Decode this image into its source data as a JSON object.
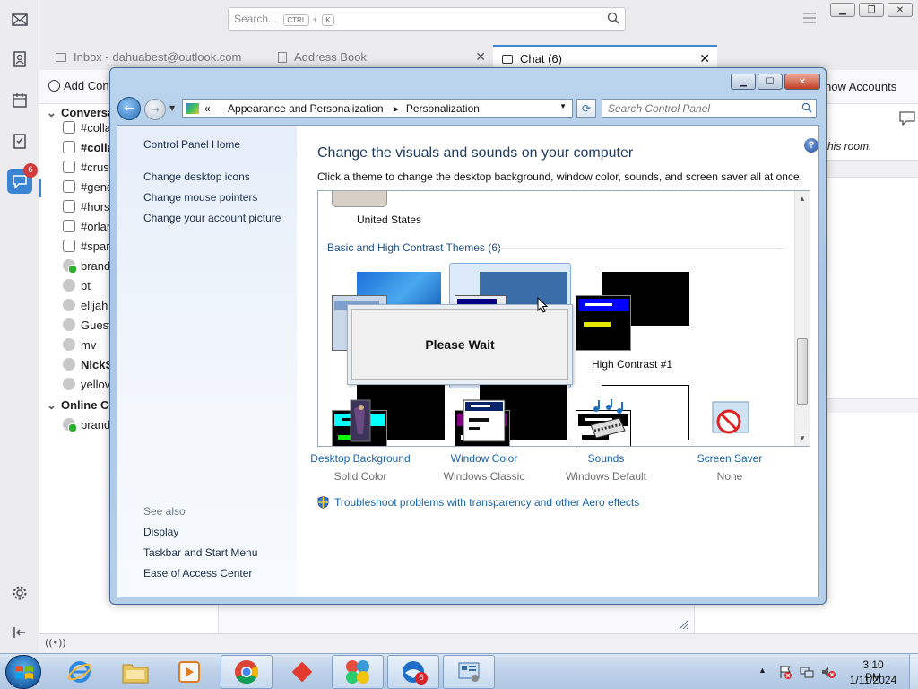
{
  "thunderbird": {
    "search_placeholder": "Search...",
    "search_kbd": [
      "CTRL",
      "K"
    ],
    "search_plus": "+",
    "tabs": [
      {
        "label": "Inbox - dahuabest@outlook.com"
      },
      {
        "label": "Address Book"
      },
      {
        "label": "Chat (6)"
      }
    ],
    "add_contact_label": "Add Cont",
    "show_accounts_label": "how Accounts",
    "chat_badge": "6",
    "groups": [
      {
        "label": "Conversat"
      },
      {
        "label": "Online Co"
      }
    ],
    "conversations": [
      {
        "label": "#colla",
        "bold": false,
        "kind": "room"
      },
      {
        "label": "#colla",
        "bold": true,
        "kind": "room"
      },
      {
        "label": "#crust",
        "bold": false,
        "kind": "room"
      },
      {
        "label": "#gene",
        "bold": false,
        "kind": "room"
      },
      {
        "label": "#hors",
        "bold": false,
        "kind": "room"
      },
      {
        "label": "#orlar",
        "bold": false,
        "kind": "room"
      },
      {
        "label": "#span",
        "bold": false,
        "kind": "room"
      },
      {
        "label": "brand",
        "bold": false,
        "kind": "online"
      },
      {
        "label": "bt",
        "bold": false,
        "kind": "person"
      },
      {
        "label": "elijah",
        "bold": false,
        "kind": "person"
      },
      {
        "label": "Guest",
        "bold": false,
        "kind": "person"
      },
      {
        "label": "mv",
        "bold": false,
        "kind": "person"
      },
      {
        "label": "NickS",
        "bold": true,
        "kind": "person"
      },
      {
        "label": "yellov",
        "bold": false,
        "kind": "person"
      }
    ],
    "online_contacts": [
      {
        "label": "brand",
        "kind": "online"
      }
    ],
    "room_note": "his room."
  },
  "control_panel": {
    "breadcrumb_prefix": "«",
    "breadcrumb": [
      "Appearance and Personalization",
      "Personalization"
    ],
    "search_placeholder": "Search Control Panel",
    "left_links": [
      {
        "label": "Control Panel Home"
      },
      {
        "label": "Change desktop icons"
      },
      {
        "label": "Change mouse pointers"
      },
      {
        "label": "Change your account picture"
      }
    ],
    "see_also_title": "See also",
    "see_also": [
      {
        "label": "Display"
      },
      {
        "label": "Taskbar and Start Menu"
      },
      {
        "label": "Ease of Access Center"
      }
    ],
    "heading": "Change the visuals and sounds on your computer",
    "subheading": "Click a theme to change the desktop background, window color, sounds, and screen saver all at once.",
    "first_theme_label": "United States",
    "basic_section_title": "Basic and High Contrast Themes (6)",
    "high_contrast_label": "High Contrast #1",
    "dialog_text": "Please Wait",
    "options": [
      {
        "link": "Desktop Background",
        "value": "Solid Color"
      },
      {
        "link": "Window Color",
        "value": "Windows Classic"
      },
      {
        "link": "Sounds",
        "value": "Windows Default"
      },
      {
        "link": "Screen Saver",
        "value": "None"
      }
    ],
    "troubleshoot": "Troubleshoot problems with transparency and other Aero effects"
  },
  "taskbar": {
    "time": "3:10 PM",
    "date": "1/11/2024",
    "thunderbird_badge": "6"
  },
  "colors": {
    "link_blue": "#1a63a8",
    "heading_blue": "#1e3a5f",
    "accent": "#3a86d4"
  }
}
